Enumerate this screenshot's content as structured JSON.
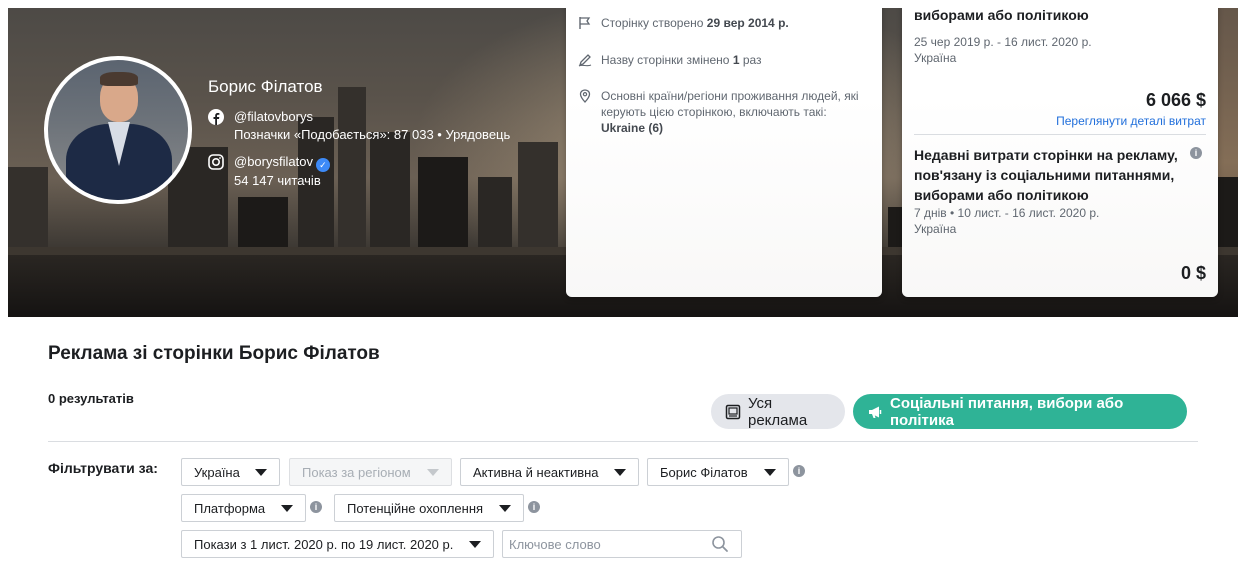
{
  "profile": {
    "name": "Борис Філатов",
    "facebook": {
      "handle": "@filatovborys",
      "stats": "Позначки «Подобається»: 87 033 • Урядовець"
    },
    "instagram": {
      "handle": "@borysfilatov",
      "followers": "54 147 читачів"
    }
  },
  "page_info": {
    "created_prefix": "Сторінку створено",
    "created_date": "29 вер 2014 р.",
    "renamed_prefix": "Назву сторінки змінено",
    "renamed_count": "1",
    "renamed_suffix": "раз",
    "countries_text": "Основні країни/регіони проживання людей, які керують цією сторінкою, включають такі:",
    "countries_value": "Ukraine (6)"
  },
  "spending": {
    "total": {
      "title_tail": "виборами або політикою",
      "period": "25 чер 2019 р. - 16 лист. 2020 р.",
      "region": "Україна",
      "amount": "6 066 $",
      "details_link": "Переглянути деталі витрат"
    },
    "recent": {
      "title": "Недавні витрати сторінки на рекламу, пов'язану із соціальними питаннями, виборами або політикою",
      "period": "7 днів • 10 лист. - 16 лист. 2020 р.",
      "region": "Україна",
      "amount": "0 $"
    }
  },
  "main": {
    "title": "Реклама зі сторінки Борис Філатов",
    "results": "0 результатів",
    "ad_type_buttons": {
      "all": "Уся реклама",
      "political": "Соціальні питання, вибори або політика"
    }
  },
  "filters": {
    "label": "Фільтрувати за:",
    "country": "Україна",
    "region": "Показ за регіоном",
    "status": "Активна й неактивна",
    "advertiser": "Борис Філатов",
    "platform": "Платформа",
    "reach": "Потенційне охоплення",
    "date_range": "Покази з 1 лист. 2020 р. по 19 лист. 2020 р.",
    "keyword_placeholder": "Ключове слово",
    "keyword_value": ""
  },
  "icons": {
    "facebook": "facebook-icon",
    "instagram": "instagram-icon",
    "verified": "verified-badge-icon",
    "flag": "flag-icon",
    "pencil": "pencil-icon",
    "location": "location-pin-icon",
    "info": "info-icon",
    "ads": "ad-library-icon",
    "megaphone": "megaphone-icon",
    "search": "search-icon",
    "caret": "caret-down-icon"
  },
  "colors": {
    "accent_green": "#2fb396",
    "link_blue": "#216fdb",
    "verified_blue": "#3d8af7",
    "pill_grey": "#e4e6eb"
  }
}
